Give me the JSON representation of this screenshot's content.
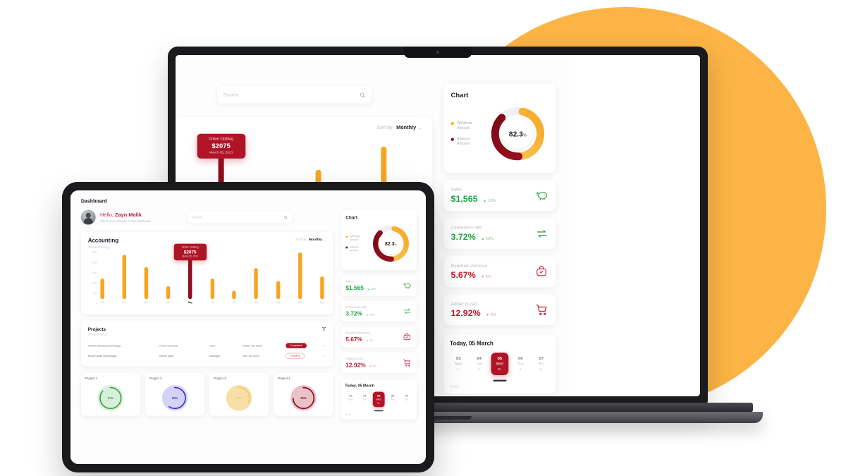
{
  "theme": {
    "bg_blob": "#FBB03B",
    "accent_orange": "#F7A521",
    "accent_red": "#B01427",
    "dark_red": "#8E0E20",
    "green": "#22A447",
    "text_dark": "#1d1d28"
  },
  "header": {
    "page_title": "Dashboard",
    "greeting_hello": "Hello, ",
    "greeting_name": "Zayn Malik",
    "greeting_sub": "Check your activities in this dashboard"
  },
  "search": {
    "placeholder": "Search",
    "value": "",
    "icon": "search-icon"
  },
  "accounting": {
    "title": "Accounting",
    "subtitle": "Overall Earning",
    "sort_label": "Sort by:",
    "sort_value": "Monthly",
    "caret": "⌄",
    "tooltip": {
      "label": "Online Clothing",
      "value": "$2075",
      "date": "March 05, 2023"
    }
  },
  "chart_data": {
    "type": "bar",
    "title": "Accounting",
    "subtitle": "Overall Earning",
    "xlabel": "",
    "ylabel": "",
    "ylim": [
      0,
      2500
    ],
    "yticks": [
      0,
      500,
      1000,
      1500,
      2000,
      2500
    ],
    "ytick_labels": [
      "0",
      "500",
      "1000",
      "1500",
      "2000",
      "2500"
    ],
    "grid": false,
    "legend": "none",
    "categories": [
      "Jan",
      "Feb",
      "Mar",
      "Apr",
      "May",
      "Jun",
      "Jul",
      "Aug",
      "Sep",
      "Oct",
      "Nov"
    ],
    "values": [
      1000,
      2150,
      1550,
      620,
      2075,
      1000,
      400,
      1500,
      880,
      2300,
      1100
    ],
    "highlight_index": 4,
    "bar_color": "#F7A521",
    "highlight_color": "#8E0E20"
  },
  "donut_chart": {
    "type": "pie",
    "title": "Chart",
    "center_value": "82.3",
    "center_unit": "%",
    "legend_position": "left",
    "series": [
      {
        "name": "Withdraw Amount",
        "value": 46,
        "color": "#F9B233"
      },
      {
        "name": "Balance Amount",
        "value": 38,
        "color": "#8E0E20"
      },
      {
        "name": "Remaining",
        "value": 16,
        "color": "#EFEFF3"
      }
    ],
    "legend": [
      "Withdraw Amount",
      "Balance Amount"
    ]
  },
  "stats": [
    {
      "label": "Sales",
      "value": "$1,565",
      "delta": "12%",
      "direction": "up",
      "tone": "green",
      "icon": "piggy-bank-icon"
    },
    {
      "label": "Conversion rate",
      "value": "3.72%",
      "delta": "23%",
      "direction": "up",
      "tone": "green",
      "icon": "exchange-arrows-icon"
    },
    {
      "label": "Reached checkout",
      "value": "5.67%",
      "delta": "2%",
      "direction": "down",
      "tone": "red",
      "icon": "checkout-bag-icon"
    },
    {
      "label": "Added to cart",
      "value": "12.92%",
      "delta": "5%",
      "direction": "down",
      "tone": "red",
      "icon": "shopping-cart-icon"
    }
  ],
  "projects": {
    "title": "Projects",
    "subtitle": "Overall Projects",
    "filter_icon": "filter-funnel-icon",
    "rows": [
      {
        "name": "Online clothing Homepage",
        "person": "Imran Survade",
        "role": "CEO",
        "date": "March 05, 2023",
        "status": "Completed",
        "status_style": "solid",
        "menu": "•••"
      },
      {
        "name": "Real Estate Homepage",
        "person": "Neetu Ingle",
        "role": "Manager",
        "date": "Dec 25, 2022",
        "status": "Ongoing",
        "status_style": "outline",
        "menu": "•••"
      }
    ]
  },
  "project_cards": [
    {
      "title": "Project 1",
      "percent": "87%",
      "value": 87,
      "color": "#3FA34D",
      "fill": "#D7F0DB"
    },
    {
      "title": "Project 2",
      "percent": "60%",
      "value": 60,
      "color": "#4233C4",
      "fill": "#D6D2F7"
    },
    {
      "title": "Project 3",
      "percent": "32%",
      "value": 32,
      "color": "#F3C66B",
      "fill": "#F8DFA8"
    },
    {
      "title": "Project 4",
      "percent": "75%",
      "value": 75,
      "color": "#8E0E20",
      "fill": "#E8C2C8"
    }
  ],
  "calendar": {
    "title": "Today, 05 March",
    "footer": "10 am",
    "days": [
      {
        "num": "03",
        "weekday": "Mon",
        "event": "4+",
        "active": false
      },
      {
        "num": "04",
        "weekday": "Tue",
        "event": "6",
        "active": false
      },
      {
        "num": "05",
        "weekday": "Wed",
        "event": "8+",
        "active": true
      },
      {
        "num": "06",
        "weekday": "Thu",
        "event": "1",
        "active": false
      },
      {
        "num": "07",
        "weekday": "Fri",
        "event": "4+",
        "active": false
      }
    ]
  }
}
